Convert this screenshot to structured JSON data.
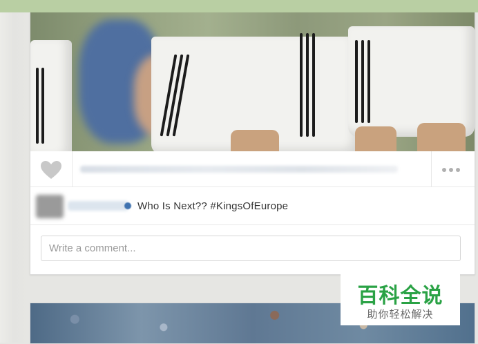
{
  "post": {
    "caption": "Who Is Next?? #KingsOfEurope",
    "comment_placeholder": "Write a comment..."
  },
  "icons": {
    "like": "heart-icon",
    "more": "more-options-icon"
  },
  "watermark": {
    "logo_text": "百科全说",
    "subtitle": "助你轻松解决"
  },
  "colors": {
    "top_bar": "#b9cfa3",
    "watermark_green": "#2aa245"
  }
}
